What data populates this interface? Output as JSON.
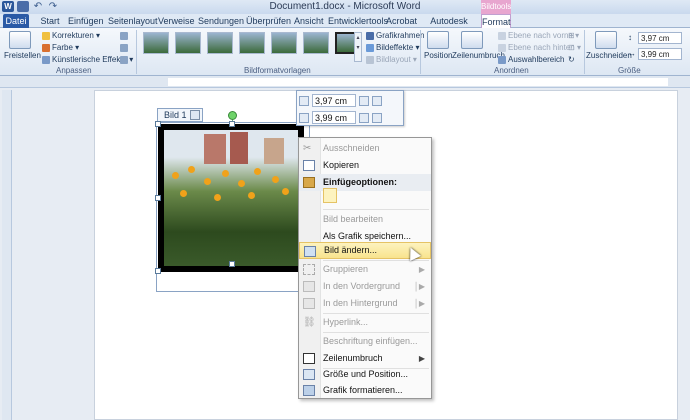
{
  "window": {
    "title": "Document1.docx - Microsoft Word",
    "context_tab_title": "Bildtools"
  },
  "tabs": [
    "Datei",
    "Start",
    "Einfügen",
    "Seitenlayout",
    "Verweise",
    "Sendungen",
    "Überprüfen",
    "Ansicht",
    "Entwicklertools",
    "Acrobat",
    "Autodesk Vault",
    "Format"
  ],
  "ribbon": {
    "freistellen": "Freistellen",
    "korrekturen": "Korrekturen",
    "farbe": "Farbe",
    "kuenstlerische": "Künstlerische Effekte",
    "anpassen_label": "Anpassen",
    "bildformatvorlagen_label": "Bildformatvorlagen",
    "grafikrahmen": "Grafikrahmen",
    "bildeffekte": "Bildeffekte",
    "bildlayout": "Bildlayout",
    "position": "Position",
    "zeilenumbruch": "Zeilenumbruch",
    "ebene_vorne": "Ebene nach vorne",
    "ebene_hinten": "Ebene nach hinten",
    "auswahlbereich": "Auswahlbereich",
    "anordnen_label": "Anordnen",
    "zuschneiden": "Zuschneiden",
    "height": "3,97 cm",
    "width": "3,99 cm",
    "groesse_label": "Größe"
  },
  "document": {
    "image_label": "Bild 1"
  },
  "mini_toolbar": {
    "height": "3,97 cm",
    "width": "3,99 cm"
  },
  "context_menu": {
    "ausschneiden": "Ausschneiden",
    "kopieren": "Kopieren",
    "einfuegeoptionen": "Einfügeoptionen:",
    "bild_bearbeiten": "Bild bearbeiten",
    "als_grafik": "Als Grafik speichern...",
    "bild_aendern": "Bild ändern...",
    "gruppieren": "Gruppieren",
    "vordergrund": "In den Vordergrund",
    "hintergrund": "In den Hintergrund",
    "hyperlink": "Hyperlink...",
    "beschriftung": "Beschriftung einfügen...",
    "zeilenumbruch": "Zeilenumbruch",
    "groesse_position": "Größe und Position...",
    "grafik_formatieren": "Grafik formatieren..."
  }
}
